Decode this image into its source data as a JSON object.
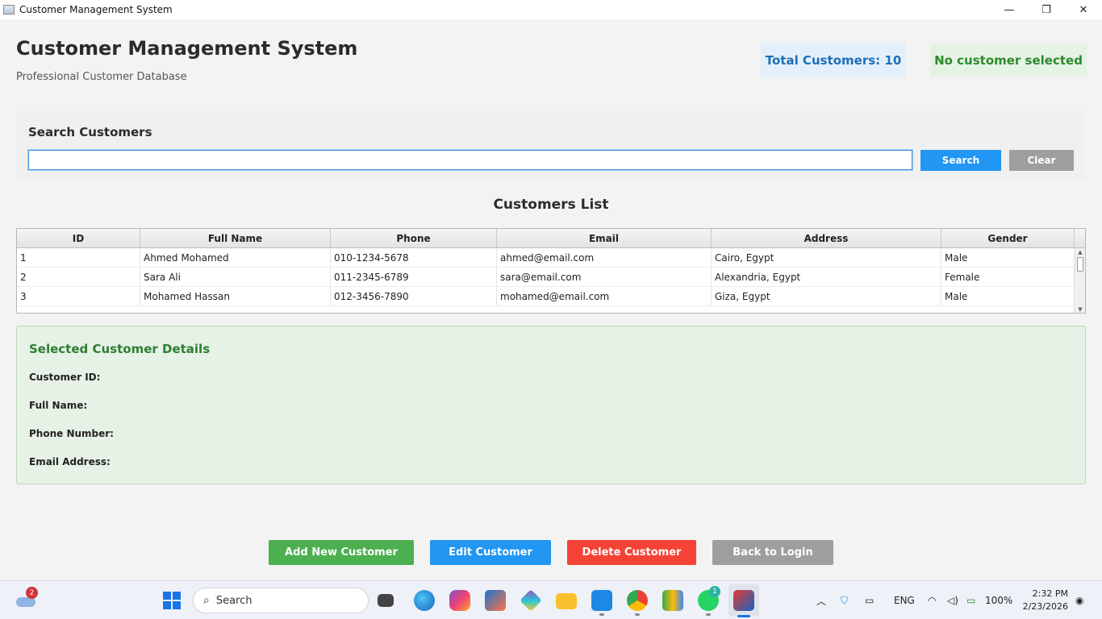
{
  "window": {
    "title": "Customer Management System",
    "controls": {
      "minimize": "—",
      "maximize": "❐",
      "close": "✕"
    }
  },
  "header": {
    "title": "Customer Management System",
    "subtitle": "Professional Customer Database",
    "total_badge": "Total Customers: 10",
    "selection_badge": "No customer selected"
  },
  "search": {
    "label": "Search Customers",
    "value": "",
    "placeholder": "",
    "search_button": "Search",
    "clear_button": "Clear"
  },
  "table": {
    "title": "Customers List",
    "columns": [
      "ID",
      "Full Name",
      "Phone",
      "Email",
      "Address",
      "Gender"
    ],
    "rows": [
      [
        "1",
        "Ahmed Mohamed",
        "010-1234-5678",
        "ahmed@email.com",
        "Cairo, Egypt",
        "Male"
      ],
      [
        "2",
        "Sara Ali",
        "011-2345-6789",
        "sara@email.com",
        "Alexandria, Egypt",
        "Female"
      ],
      [
        "3",
        "Mohamed Hassan",
        "012-3456-7890",
        "mohamed@email.com",
        "Giza, Egypt",
        "Male"
      ]
    ]
  },
  "details": {
    "title": "Selected Customer Details",
    "labels": [
      "Customer ID:",
      "Full Name:",
      "Phone Number:",
      "Email Address:"
    ]
  },
  "actions": {
    "add": "Add New Customer",
    "edit": "Edit Customer",
    "delete": "Delete Customer",
    "back": "Back to Login"
  },
  "taskbar": {
    "weather_badge": "2",
    "search_text": "Search",
    "language": "ENG",
    "battery": "100%",
    "time": "2:32 PM",
    "date": "2/23/2026",
    "whatsapp_badge": "1"
  },
  "colors": {
    "primary": "#2196f3",
    "success": "#4caf50",
    "danger": "#f44336",
    "neutral": "#9e9e9e",
    "details_bg": "#e6f2e6"
  }
}
